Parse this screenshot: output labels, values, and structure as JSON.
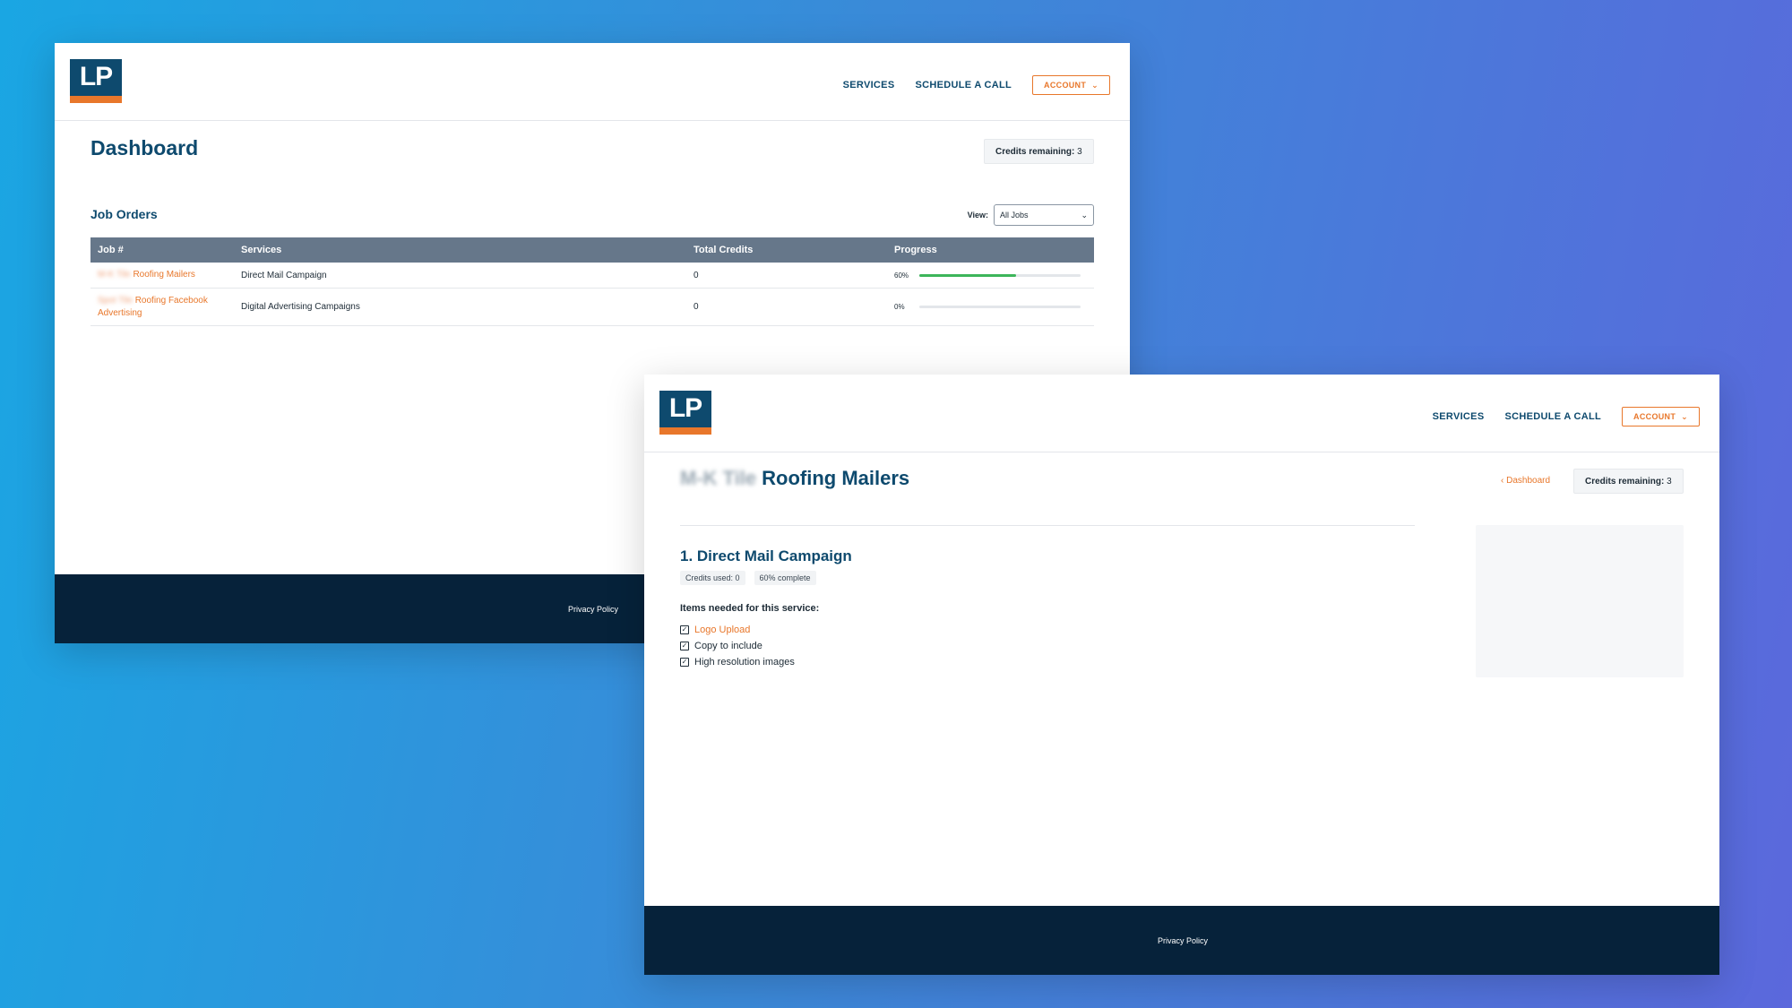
{
  "brand": {
    "logo_text": "LP",
    "accent": "#e8772b",
    "primary": "#0e4a6e",
    "footer_bg": "#06223a"
  },
  "nav": {
    "services": "SERVICES",
    "schedule": "SCHEDULE A CALL",
    "account": "ACCOUNT"
  },
  "dashboard": {
    "title": "Dashboard",
    "credits_label": "Credits remaining:",
    "credits_value": "3",
    "section_title": "Job Orders",
    "view_label": "View:",
    "view_selected": "All Jobs",
    "columns": [
      "Job #",
      "Services",
      "Total Credits",
      "Progress"
    ],
    "rows": [
      {
        "job_blurred": "M-K Tile",
        "job_name": "Roofing Mailers",
        "job_name2": "",
        "service": "Direct Mail Campaign",
        "credits": "0",
        "progress_label": "60%",
        "progress": 0.6
      },
      {
        "job_blurred": "Spot Tile",
        "job_name": "Roofing Facebook",
        "job_name2": "Advertising",
        "service": "Digital Advertising Campaigns",
        "credits": "0",
        "progress_label": "0%",
        "progress": 0
      }
    ]
  },
  "footer": {
    "privacy": "Privacy Policy"
  },
  "detail": {
    "title_blurred": "M-K Tile",
    "title": "Roofing Mailers",
    "back": "Dashboard",
    "credits_label": "Credits remaining:",
    "credits_value": "3",
    "service_title": "1. Direct Mail Campaign",
    "credits_used": "Credits used: 0",
    "complete": "60% complete",
    "items_title": "Items needed for this service:",
    "items": [
      {
        "label": "Logo Upload",
        "link": true
      },
      {
        "label": "Copy to include",
        "link": false
      },
      {
        "label": "High resolution images",
        "link": false
      }
    ]
  }
}
